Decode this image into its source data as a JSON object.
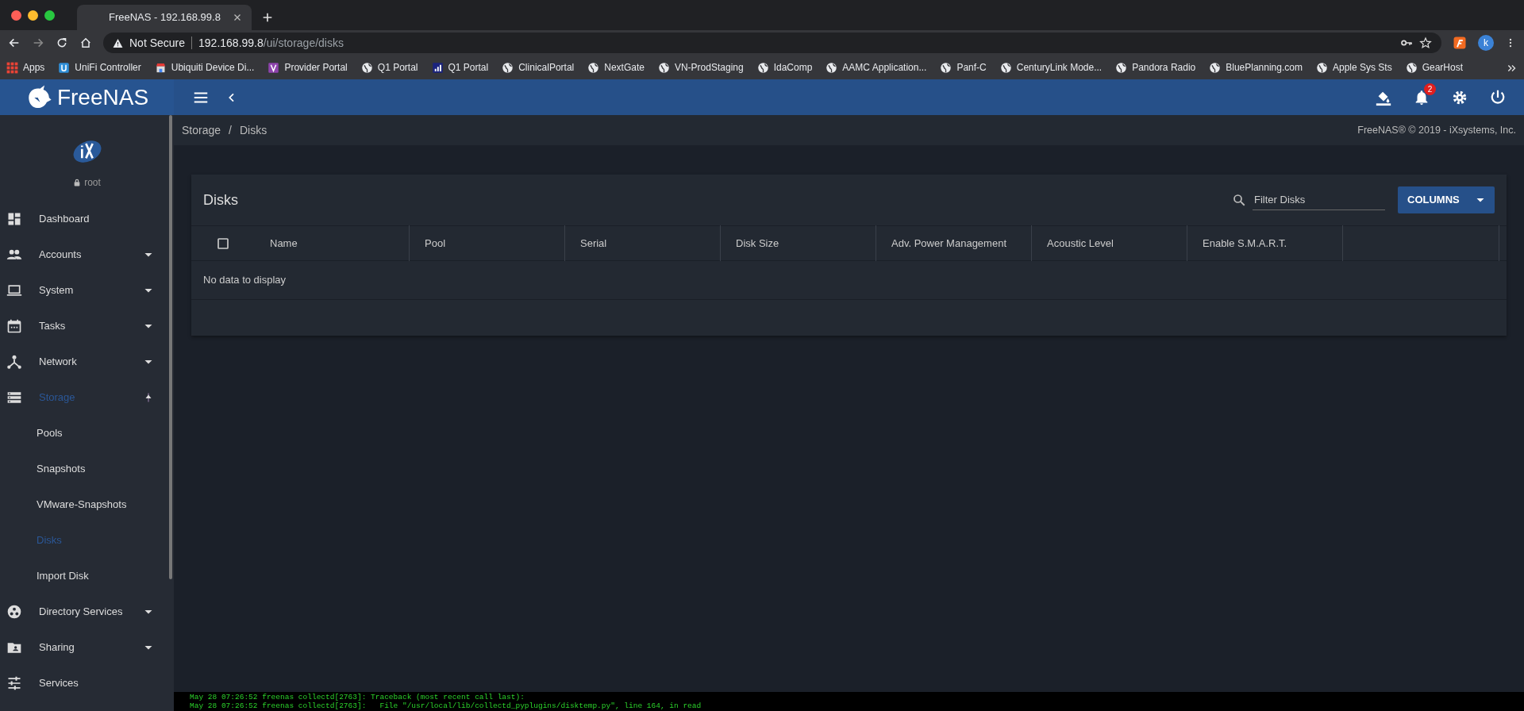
{
  "browser": {
    "tab_title": "FreeNAS - 192.168.99.8",
    "security": "Not Secure",
    "url_host": "192.168.99.8",
    "url_path": "/ui/storage/disks",
    "profile": "k",
    "bookmarks": [
      {
        "label": "Apps",
        "kind": "apps"
      },
      {
        "label": "UniFi Controller",
        "kind": "unifi"
      },
      {
        "label": "Ubiquiti Device Di...",
        "kind": "shop"
      },
      {
        "label": "Provider Portal",
        "kind": "v"
      },
      {
        "label": "Q1 Portal",
        "kind": "globe"
      },
      {
        "label": "Q1 Portal",
        "kind": "bars"
      },
      {
        "label": "ClinicalPortal",
        "kind": "globe"
      },
      {
        "label": "NextGate",
        "kind": "globe"
      },
      {
        "label": "VN-ProdStaging",
        "kind": "globe"
      },
      {
        "label": "IdaComp",
        "kind": "globe"
      },
      {
        "label": "AAMC Application...",
        "kind": "globe"
      },
      {
        "label": "Panf-C",
        "kind": "globe"
      },
      {
        "label": "CenturyLink Mode...",
        "kind": "globe"
      },
      {
        "label": "Pandora Radio",
        "kind": "globe"
      },
      {
        "label": "BluePlanning.com",
        "kind": "globe"
      },
      {
        "label": "Apple Sys Sts",
        "kind": "globe"
      },
      {
        "label": "GearHost",
        "kind": "globe"
      }
    ]
  },
  "header": {
    "logo": "FreeNAS",
    "notification_count": "2"
  },
  "breadcrumb": {
    "separator": "/",
    "items": [
      "Storage",
      "Disks"
    ]
  },
  "copyright": "FreeNAS® © 2019 - iXsystems, Inc.",
  "sidebar": {
    "user": "root",
    "items": [
      {
        "label": "Dashboard",
        "selected": false
      },
      {
        "label": "Accounts",
        "expanded": false,
        "selected": false
      },
      {
        "label": "System",
        "expanded": false,
        "selected": false
      },
      {
        "label": "Tasks",
        "expanded": false,
        "selected": false
      },
      {
        "label": "Network",
        "expanded": false,
        "selected": false
      },
      {
        "label": "Storage",
        "expanded": true,
        "selected": true,
        "children": [
          {
            "label": "Pools",
            "selected": false
          },
          {
            "label": "Snapshots",
            "selected": false
          },
          {
            "label": "VMware-Snapshots",
            "selected": false
          },
          {
            "label": "Disks",
            "selected": true
          },
          {
            "label": "Import Disk",
            "selected": false
          }
        ]
      },
      {
        "label": "Directory Services",
        "expanded": false,
        "selected": false
      },
      {
        "label": "Sharing",
        "expanded": false,
        "selected": false
      },
      {
        "label": "Services",
        "selected": false
      }
    ]
  },
  "card": {
    "title": "Disks",
    "filter_placeholder": "Filter Disks",
    "columns_button": "COLUMNS",
    "select_all_checked": false,
    "columns": [
      "Name",
      "Pool",
      "Serial",
      "Disk Size",
      "Adv. Power Management",
      "Acoustic Level",
      "Enable S.M.A.R.T."
    ],
    "empty_message": "No data to display"
  },
  "console": [
    "May 28 07:26:52 freenas collectd[2763]: Traceback (most recent call last):",
    "May 28 07:26:52 freenas collectd[2763]:   File \"/usr/local/lib/collectd_pyplugins/disktemp.py\", line 164, in read"
  ]
}
